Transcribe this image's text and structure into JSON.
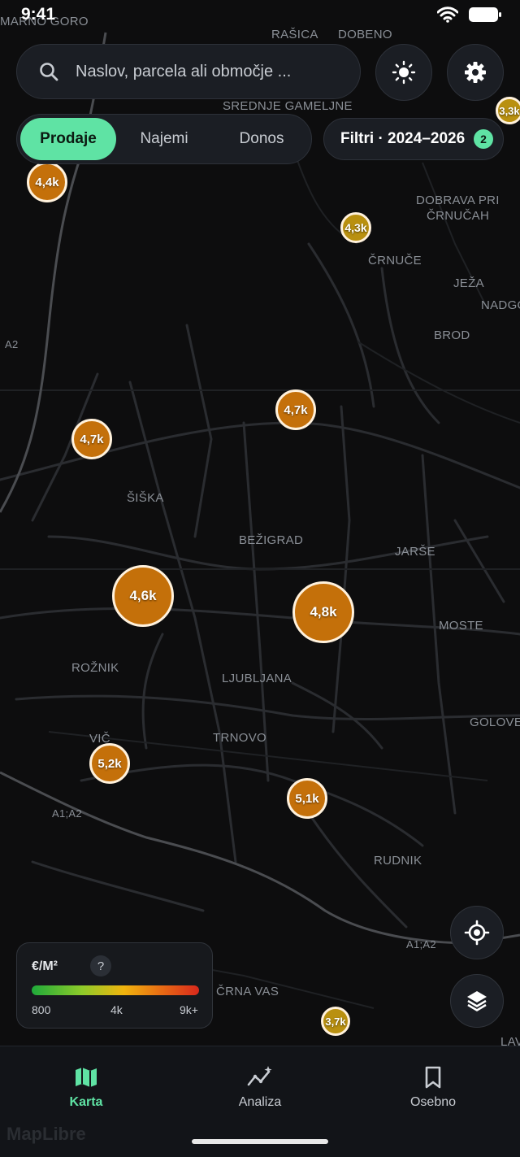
{
  "status_bar": {
    "time": "9:41"
  },
  "search": {
    "placeholder": "Naslov, parcela ali območje ..."
  },
  "top_buttons": {
    "theme": "sun-icon",
    "settings": "gear-icon"
  },
  "segments": [
    {
      "label": "Prodaje",
      "active": true
    },
    {
      "label": "Najemi",
      "active": false
    },
    {
      "label": "Donos",
      "active": false
    }
  ],
  "filters": {
    "label": "Filtri · 2024–2026",
    "count": "2"
  },
  "place_labels": [
    {
      "id": "mamo-goro",
      "text": "MARNO GORO"
    },
    {
      "id": "rasica",
      "text": "RAŠICA"
    },
    {
      "id": "dobeno",
      "text": "DOBENO"
    },
    {
      "id": "srednje-gamelje",
      "text": "SREDNJE GAMELJNE"
    },
    {
      "id": "dobrava",
      "text": "DOBRAVA PRI"
    },
    {
      "id": "crnucah",
      "text": "ČRNUČAH"
    },
    {
      "id": "crnuce",
      "text": "ČRNUČE"
    },
    {
      "id": "jeza",
      "text": "JEŽA"
    },
    {
      "id": "nadgo",
      "text": "NADGO"
    },
    {
      "id": "brod",
      "text": "BROD"
    },
    {
      "id": "a2",
      "text": "A2"
    },
    {
      "id": "siska",
      "text": "ŠIŠKA"
    },
    {
      "id": "bezigrad",
      "text": "BEŽIGRAD"
    },
    {
      "id": "jarse",
      "text": "JARŠE"
    },
    {
      "id": "moste",
      "text": "MOSTE"
    },
    {
      "id": "roznik",
      "text": "ROŽNIK"
    },
    {
      "id": "ljubljana",
      "text": "LJUBLJANA"
    },
    {
      "id": "golovec",
      "text": "GOLOVEC"
    },
    {
      "id": "vic",
      "text": "VIČ"
    },
    {
      "id": "trnovo",
      "text": "TRNOVO"
    },
    {
      "id": "a1a2",
      "text": "A1;A2"
    },
    {
      "id": "rudnik",
      "text": "RUDNIK"
    },
    {
      "id": "a1a2-east",
      "text": "A1;A2"
    },
    {
      "id": "crna-vas",
      "text": "ČRNA VAS"
    },
    {
      "id": "lav",
      "text": "LAV"
    }
  ],
  "price_markers": [
    {
      "id": "m1",
      "label": "4,4k",
      "value_eur_m2": 4400
    },
    {
      "id": "m2",
      "label": "4,3k",
      "value_eur_m2": 4300
    },
    {
      "id": "m3",
      "label": "3,3k",
      "value_eur_m2": 3300
    },
    {
      "id": "m4",
      "label": "4,7k",
      "value_eur_m2": 4700
    },
    {
      "id": "m5",
      "label": "4,7k",
      "value_eur_m2": 4700
    },
    {
      "id": "m6",
      "label": "4,6k",
      "value_eur_m2": 4600
    },
    {
      "id": "m7",
      "label": "4,8k",
      "value_eur_m2": 4800
    },
    {
      "id": "m8",
      "label": "5,2k",
      "value_eur_m2": 5200
    },
    {
      "id": "m9",
      "label": "5,1k",
      "value_eur_m2": 5100
    },
    {
      "id": "m10",
      "label": "3,7k",
      "value_eur_m2": 3700
    }
  ],
  "legend": {
    "title": "€/M²",
    "help": "?",
    "ticks": [
      "800",
      "4k",
      "9k+"
    ],
    "colors": [
      "#1faa3a",
      "#8ecb2a",
      "#f0b40e",
      "#e86a14",
      "#d8281c"
    ]
  },
  "fabs": {
    "locate": "locate-icon",
    "layers": "layers-icon"
  },
  "bottom_nav": [
    {
      "label": "Karta",
      "icon": "map-icon",
      "active": true
    },
    {
      "label": "Analiza",
      "icon": "analytics-icon",
      "active": false
    },
    {
      "label": "Osebno",
      "icon": "bookmark-icon",
      "active": false
    }
  ],
  "attribution": "MapLibre",
  "accent_color": "#5fe3a4",
  "marker_color": "#c4700a"
}
